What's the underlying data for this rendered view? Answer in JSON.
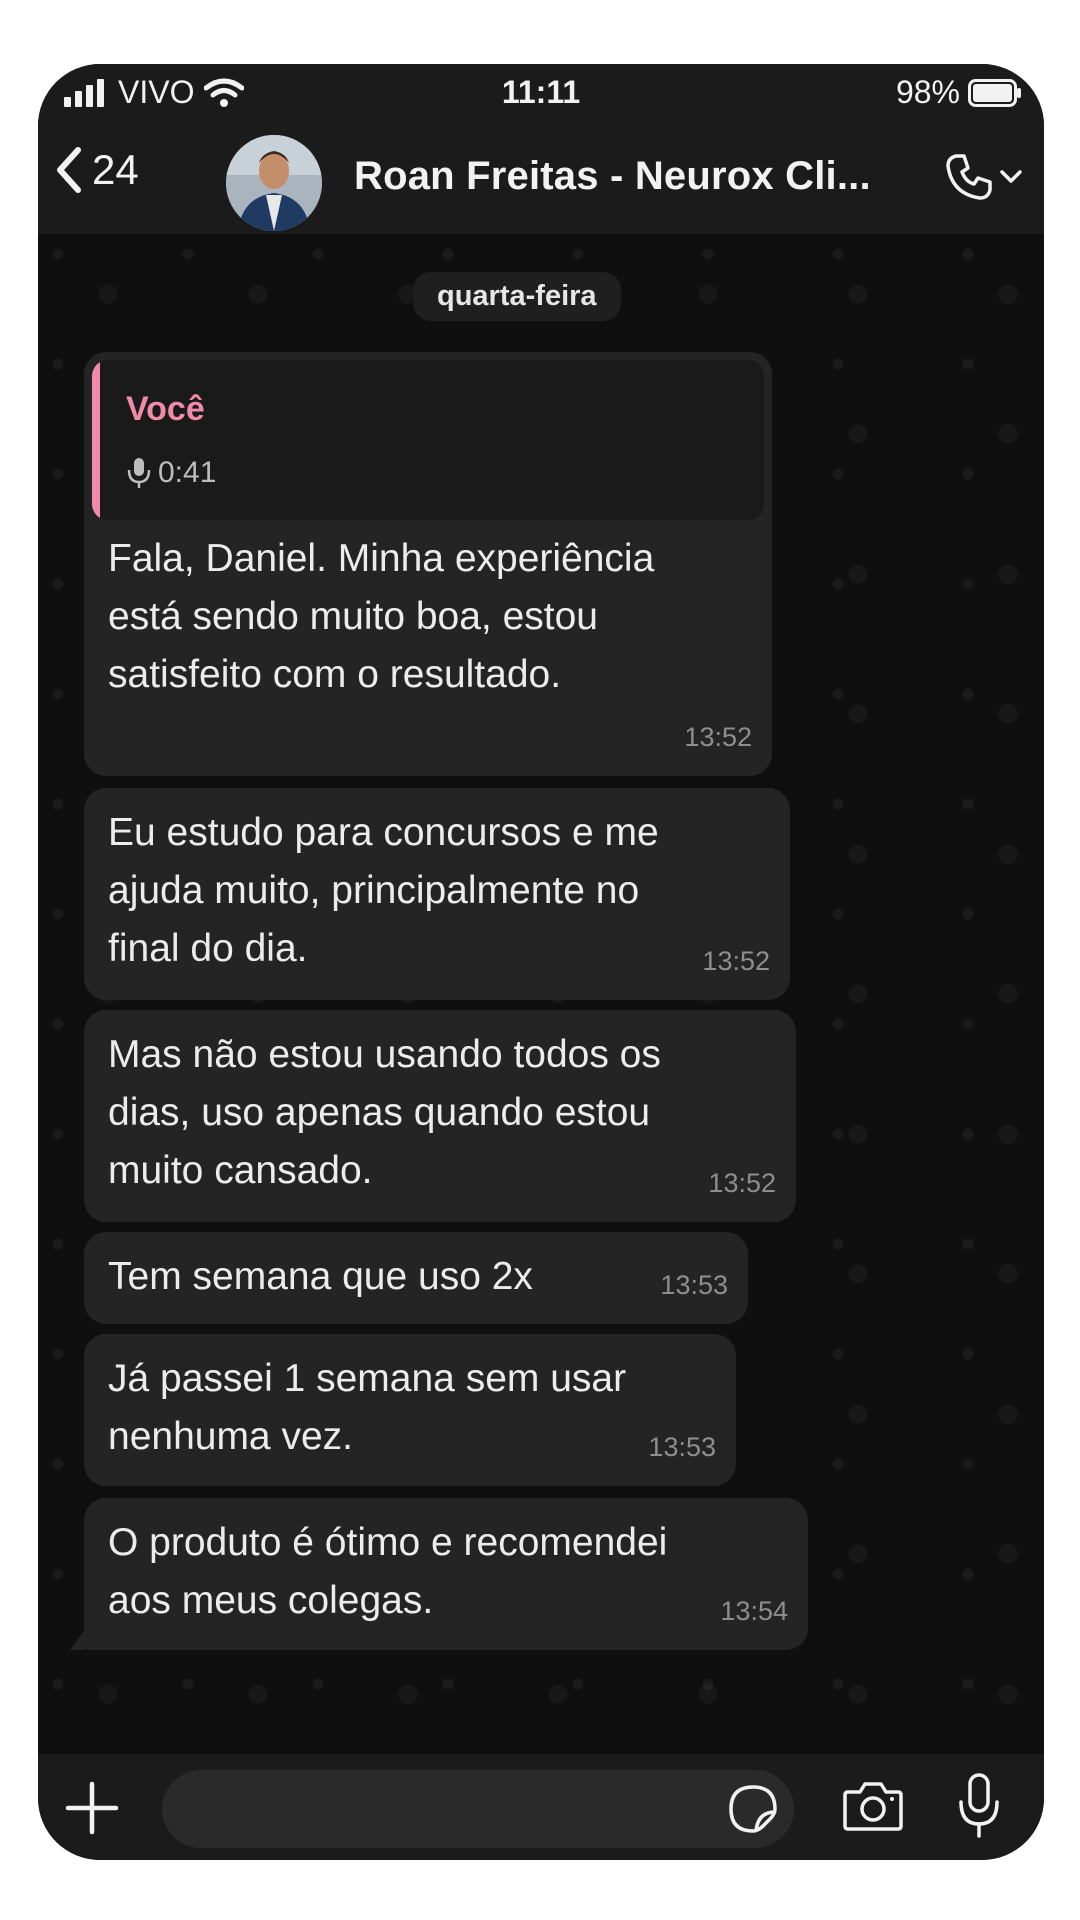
{
  "status_bar": {
    "carrier": "VIVO",
    "time": "11:11",
    "battery": "98%",
    "icons": [
      "signal-icon",
      "wifi-icon",
      "battery-icon"
    ]
  },
  "header": {
    "back_count": "24",
    "contact_name": "Roan Freitas - Neurox Cli...",
    "icons": [
      "back-chevron-icon",
      "avatar",
      "phone-call-icon",
      "chevron-down-icon"
    ]
  },
  "chat": {
    "day_label": "quarta-feira",
    "quoted": {
      "author": "Você",
      "duration": "0:41",
      "icon": "microphone-icon"
    },
    "messages": [
      {
        "text": "Fala, Daniel. Minha experiência\nestá sendo muito boa, estou\nsatisfeito com o resultado.",
        "time": "13:52"
      },
      {
        "text": "Eu estudo para concursos e me\najuda muito, principalmente no\nfinal do dia.",
        "time": "13:52"
      },
      {
        "text": "Mas não estou usando todos os\ndias, uso apenas quando estou\nmuito cansado.",
        "time": "13:52"
      },
      {
        "text": "Tem semana que uso 2x",
        "time": "13:53"
      },
      {
        "text": "Já passei 1 semana sem usar\nnenhuma vez.",
        "time": "13:53"
      },
      {
        "text": "O produto é ótimo e recomendei\naos meus colegas.",
        "time": "13:54"
      }
    ]
  },
  "input_bar": {
    "icons": [
      "plus-icon",
      "sticker-icon",
      "camera-icon",
      "microphone-icon"
    ]
  },
  "colors": {
    "quote_accent": "#f08aa7",
    "bubble": "#242424",
    "background": "#0f0f0f"
  }
}
